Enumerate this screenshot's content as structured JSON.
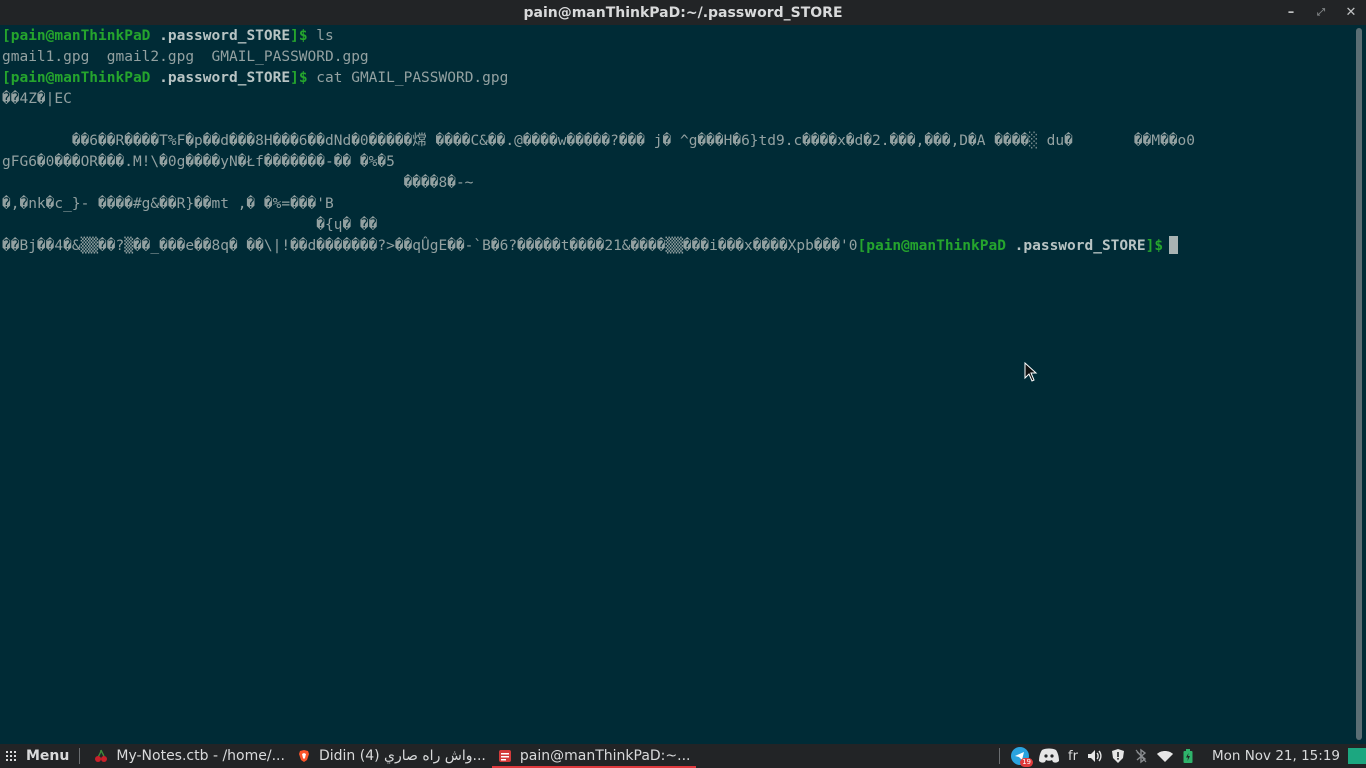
{
  "window": {
    "title": "pain@manThinkPaD:~/.password_STORE",
    "minimize_glyph": "–",
    "restore_glyph": "⤢",
    "close_glyph": "✕"
  },
  "terminal": {
    "prompt_user": "[pain@manThinkPaD",
    "prompt_dir": ".password_STORE",
    "prompt_end": "]$",
    "cmd1": " ls",
    "ls_output": "gmail1.gpg  gmail2.gpg  GMAIL_PASSWORD.gpg",
    "cmd2": " cat GMAIL_PASSWORD.gpg",
    "garbage": [
      "��4Z�|EC",
      "",
      "        ��6��R����T%F�p��d���8H���6��dNd�0�����龦 ����C&��.@����w�����?��� j� ^g���H�6}td9.c����x�d�2.���,���,D�A ����░ du�       ��M��o0",
      "gFG6�0���OR���.M!\\�0g����yN�Łf�������-�� �%�5",
      "                                              ����8�-~",
      "�,�nk�c_}- ����#g&��R}��mt ,� �%=���'B",
      "                                    �{ɥ� ��",
      "��Bj��4�&▒▒��?▒��_���e��8q� ��\\|!��d�������?>��qÛgE��-`B�6?�����t����21&����▒▒���i���x����Xpb���'0"
    ],
    "last_prompt_user": "[pain@manThinkPaD",
    "last_prompt_dir": ".password_STORE",
    "last_prompt_end": "]$"
  },
  "taskbar": {
    "menu_label": "Menu",
    "tasks": [
      {
        "label": "My-Notes.ctb - /home/...",
        "icon": "cherry-icon"
      },
      {
        "label": "Didin واش راه صاري (4)...",
        "icon": "brave-icon"
      },
      {
        "label": "pain@manThinkPaD:~...",
        "icon": "terminal-icon"
      }
    ],
    "telegram_badge": "19",
    "keyboard_layout": "fr",
    "clock": "Mon Nov 21, 15:19"
  },
  "colors": {
    "terminal_bg": "#002b36",
    "prompt_green": "#25a52d",
    "panel_bg": "#222426",
    "active_task_underline": "#e0393e"
  }
}
